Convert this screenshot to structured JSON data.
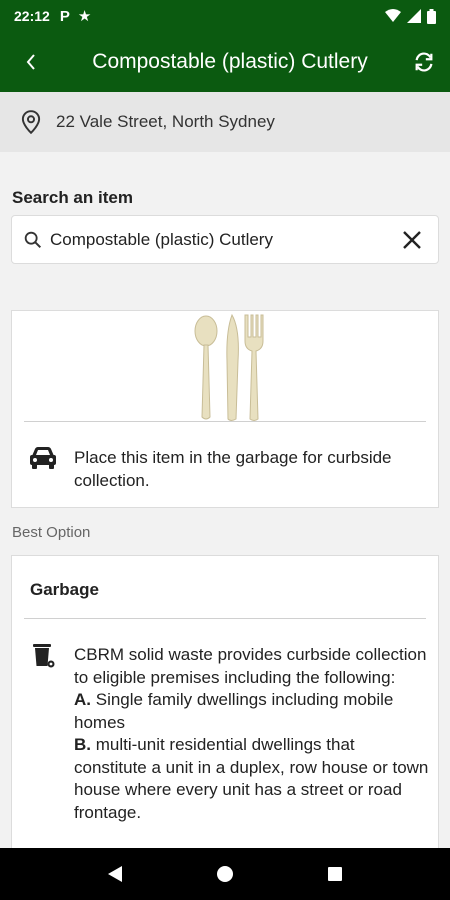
{
  "status_bar": {
    "time": "22:12",
    "left_icons": [
      "parking-icon",
      "star-icon"
    ],
    "right_icons": [
      "wifi-icon",
      "signal-icon",
      "battery-icon"
    ]
  },
  "app_bar": {
    "title": "Compostable (plastic) Cutlery",
    "back_icon": "back-arrow-icon",
    "refresh_icon": "refresh-icon"
  },
  "location": {
    "address": "22 Vale Street, North Sydney",
    "icon": "location-pin-icon"
  },
  "search": {
    "label": "Search an item",
    "value": "Compostable (plastic) Cutlery",
    "icon": "search-icon",
    "clear_icon": "close-icon"
  },
  "item_card": {
    "image": "cutlery-image",
    "icon": "car-icon",
    "instruction": "Place this item in the garbage for curbside collection."
  },
  "best_option_label": "Best Option",
  "option_card": {
    "title": "Garbage",
    "icon": "garbage-bin-icon",
    "intro": "CBRM solid waste provides curbside collection to eligible premises including the following:",
    "items": [
      {
        "marker": "A.",
        "text": "Single family dwellings including mobile homes"
      },
      {
        "marker": "B.",
        "text": "multi-unit residential dwellings that constitute a unit in a duplex, row house or town house where every unit has a street or road frontage."
      }
    ]
  },
  "nav_bar": {
    "back_icon": "nav-back-icon",
    "home_icon": "nav-home-icon",
    "recents_icon": "nav-recents-icon"
  },
  "colors": {
    "primary": "#0b5a10",
    "background": "#f2f2f2",
    "location_bar": "#e6e6e6"
  }
}
